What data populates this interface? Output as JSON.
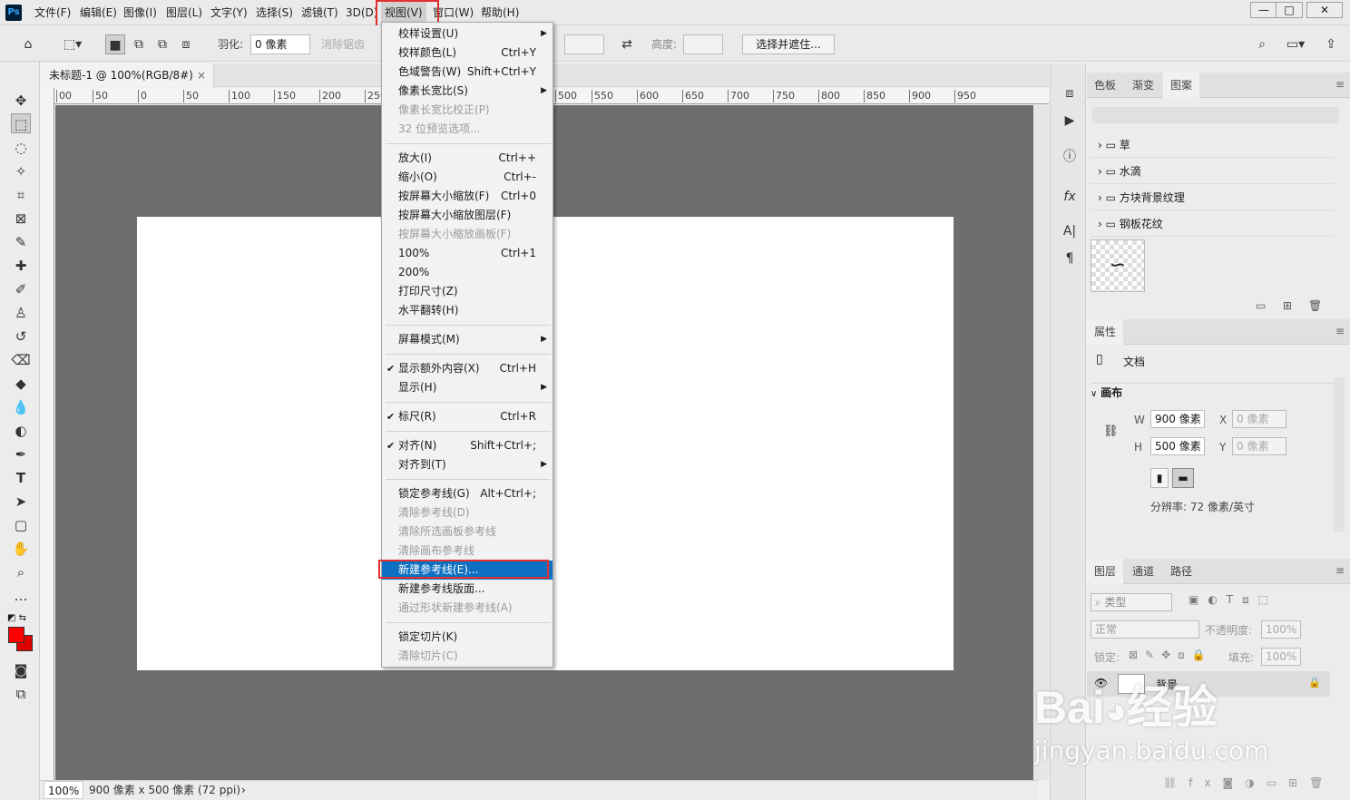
{
  "menubar": {
    "logo": "Ps",
    "items": [
      "文件(F)",
      "编辑(E)",
      "图像(I)",
      "图层(L)",
      "文字(Y)",
      "选择(S)",
      "滤镜(T)",
      "3D(D)",
      "视图(V)",
      "窗口(W)",
      "帮助(H)"
    ],
    "active_index": 8,
    "window_controls": [
      "—",
      "□",
      "✕"
    ]
  },
  "options": {
    "feather_label": "羽化:",
    "feather_value": "0 像素",
    "antialias_label": "消除锯齿",
    "height_label": "高度:",
    "select_mask_button": "选择并遮住..."
  },
  "document": {
    "tab_title": "未标题-1 @ 100%(RGB/8#)",
    "tab_close": "×",
    "canvas_color": "#ffffff"
  },
  "ruler": {
    "h_labels": [
      "00",
      "50",
      "0",
      "50",
      "100",
      "150",
      "200",
      "250",
      "500",
      "550",
      "600",
      "650",
      "700",
      "750",
      "800",
      "850",
      "900",
      "950"
    ]
  },
  "status": {
    "zoom": "100%",
    "info": "900 像素 x 500 像素 (72 ppi)",
    "arrow": "›"
  },
  "view_menu": {
    "items": [
      {
        "label": "校样设置(U)",
        "shortcut": "",
        "sub": true,
        "state": "normal"
      },
      {
        "label": "校样颜色(L)",
        "shortcut": "Ctrl+Y",
        "state": "normal"
      },
      {
        "label": "色域警告(W)",
        "shortcut": "Shift+Ctrl+Y",
        "state": "normal"
      },
      {
        "label": "像素长宽比(S)",
        "shortcut": "",
        "sub": true,
        "state": "normal"
      },
      {
        "label": "像素长宽比校正(P)",
        "shortcut": "",
        "state": "disabled"
      },
      {
        "label": "32 位预览选项...",
        "shortcut": "",
        "state": "disabled"
      },
      {
        "sep": true
      },
      {
        "label": "放大(I)",
        "shortcut": "Ctrl++",
        "state": "normal"
      },
      {
        "label": "缩小(O)",
        "shortcut": "Ctrl+-",
        "state": "normal"
      },
      {
        "label": "按屏幕大小缩放(F)",
        "shortcut": "Ctrl+0",
        "state": "normal"
      },
      {
        "label": "按屏幕大小缩放图层(F)",
        "shortcut": "",
        "state": "normal"
      },
      {
        "label": "按屏幕大小缩放画板(F)",
        "shortcut": "",
        "state": "disabled"
      },
      {
        "label": "100%",
        "shortcut": "Ctrl+1",
        "state": "normal"
      },
      {
        "label": "200%",
        "shortcut": "",
        "state": "normal"
      },
      {
        "label": "打印尺寸(Z)",
        "shortcut": "",
        "state": "normal"
      },
      {
        "label": "水平翻转(H)",
        "shortcut": "",
        "state": "normal"
      },
      {
        "sep": true
      },
      {
        "label": "屏幕模式(M)",
        "shortcut": "",
        "sub": true,
        "state": "normal"
      },
      {
        "sep": true
      },
      {
        "label": "显示额外内容(X)",
        "shortcut": "Ctrl+H",
        "checked": true,
        "state": "normal"
      },
      {
        "label": "显示(H)",
        "shortcut": "",
        "sub": true,
        "state": "normal"
      },
      {
        "sep": true
      },
      {
        "label": "标尺(R)",
        "shortcut": "Ctrl+R",
        "checked": true,
        "state": "normal"
      },
      {
        "sep": true
      },
      {
        "label": "对齐(N)",
        "shortcut": "Shift+Ctrl+;",
        "checked": true,
        "state": "normal"
      },
      {
        "label": "对齐到(T)",
        "shortcut": "",
        "sub": true,
        "state": "normal"
      },
      {
        "sep": true
      },
      {
        "label": "锁定参考线(G)",
        "shortcut": "Alt+Ctrl+;",
        "state": "normal"
      },
      {
        "label": "清除参考线(D)",
        "shortcut": "",
        "state": "disabled"
      },
      {
        "label": "清除所选画板参考线",
        "shortcut": "",
        "state": "disabled"
      },
      {
        "label": "清除画布参考线",
        "shortcut": "",
        "state": "disabled"
      },
      {
        "label": "新建参考线(E)...",
        "shortcut": "",
        "state": "selected"
      },
      {
        "label": "新建参考线版面...",
        "shortcut": "",
        "state": "normal"
      },
      {
        "label": "通过形状新建参考线(A)",
        "shortcut": "",
        "state": "disabled"
      },
      {
        "sep": true
      },
      {
        "label": "锁定切片(K)",
        "shortcut": "",
        "state": "normal"
      },
      {
        "label": "清除切片(C)",
        "shortcut": "",
        "state": "disabled"
      }
    ]
  },
  "swatches_panel": {
    "tabs": [
      "色板",
      "渐变",
      "图案"
    ],
    "selected_tab": 2,
    "groups": [
      "草",
      "水滴",
      "方块背景纹理",
      "钢板花纹"
    ]
  },
  "properties_panel": {
    "tab": "属性",
    "doc_label": "文档",
    "section": "画布",
    "w_label": "W",
    "w_value": "900 像素",
    "h_label": "H",
    "h_value": "500 像素",
    "x_label": "X",
    "x_value": "0 像素",
    "y_label": "Y",
    "y_value": "0 像素",
    "resolution": "分辨率: 72 像素/英寸"
  },
  "layers_panel": {
    "tabs": [
      "图层",
      "通道",
      "路径"
    ],
    "filter_kind": "类型",
    "blend_mode": "正常",
    "opacity_label": "不透明度:",
    "opacity_value": "100%",
    "lock_label": "锁定:",
    "fill_label": "填充:",
    "fill_value": "100%",
    "layer_name": "背景"
  },
  "watermark": {
    "brand": "Bai",
    "brand2": "经验",
    "url": "jingyan.baidu.com"
  },
  "colors": {
    "accent_selected": "#0e70c0",
    "highlight_red": "#e03030",
    "foreground": "#ff0000",
    "background": "#e00000"
  }
}
